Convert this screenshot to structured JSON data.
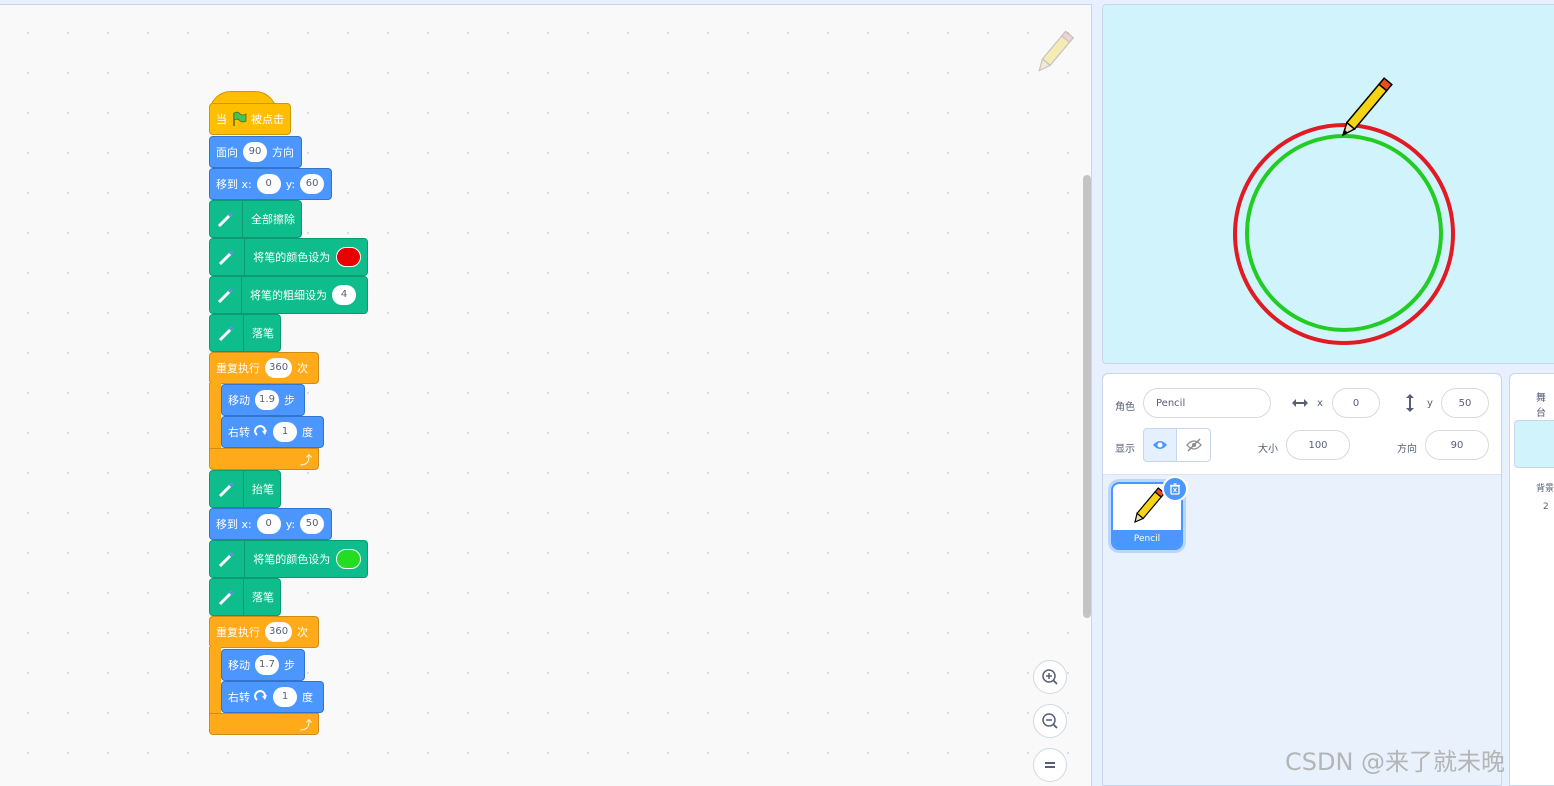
{
  "blocks": {
    "when_flag": {
      "left": "当",
      "right": "被点击"
    },
    "point_dir": {
      "label": "面向",
      "value": "90",
      "suffix": "方向"
    },
    "goto1": {
      "label": "移到 x:",
      "x": "0",
      "ylabel": "y:",
      "y": "60"
    },
    "erase_all": "全部擦除",
    "set_color1": {
      "label": "将笔的颜色设为",
      "color": "#e60000"
    },
    "set_size": {
      "label": "将笔的粗细设为",
      "value": "4"
    },
    "pen_down1": "落笔",
    "repeat1": {
      "label": "重复执行",
      "value": "360",
      "suffix": "次"
    },
    "move1": {
      "label": "移动",
      "value": "1.9",
      "suffix": "步"
    },
    "turn1": {
      "label": "右转",
      "value": "1",
      "suffix": "度"
    },
    "pen_up": "抬笔",
    "goto2": {
      "label": "移到 x:",
      "x": "0",
      "ylabel": "y:",
      "y": "50"
    },
    "set_color2": {
      "label": "将笔的颜色设为",
      "color": "#22dd22"
    },
    "pen_down2": "落笔",
    "repeat2": {
      "label": "重复执行",
      "value": "360",
      "suffix": "次"
    },
    "move2": {
      "label": "移动",
      "value": "1.7",
      "suffix": "步"
    },
    "turn2": {
      "label": "右转",
      "value": "1",
      "suffix": "度"
    }
  },
  "sprite_info": {
    "sprite_label": "角色",
    "sprite_name": "Pencil",
    "x_label": "x",
    "x": "0",
    "y_label": "y",
    "y": "50",
    "show_label": "显示",
    "size_label": "大小",
    "size": "100",
    "direction_label": "方向",
    "direction": "90"
  },
  "sprite_list": [
    {
      "name": "Pencil"
    }
  ],
  "stage_pane": {
    "title": "舞台",
    "backdrops_label": "背景",
    "backdrops_count": "2"
  },
  "stage": {
    "circle1_color": "#e01b24",
    "circle2_color": "#22cc22"
  },
  "watermark": "CSDN @来了就未晚"
}
